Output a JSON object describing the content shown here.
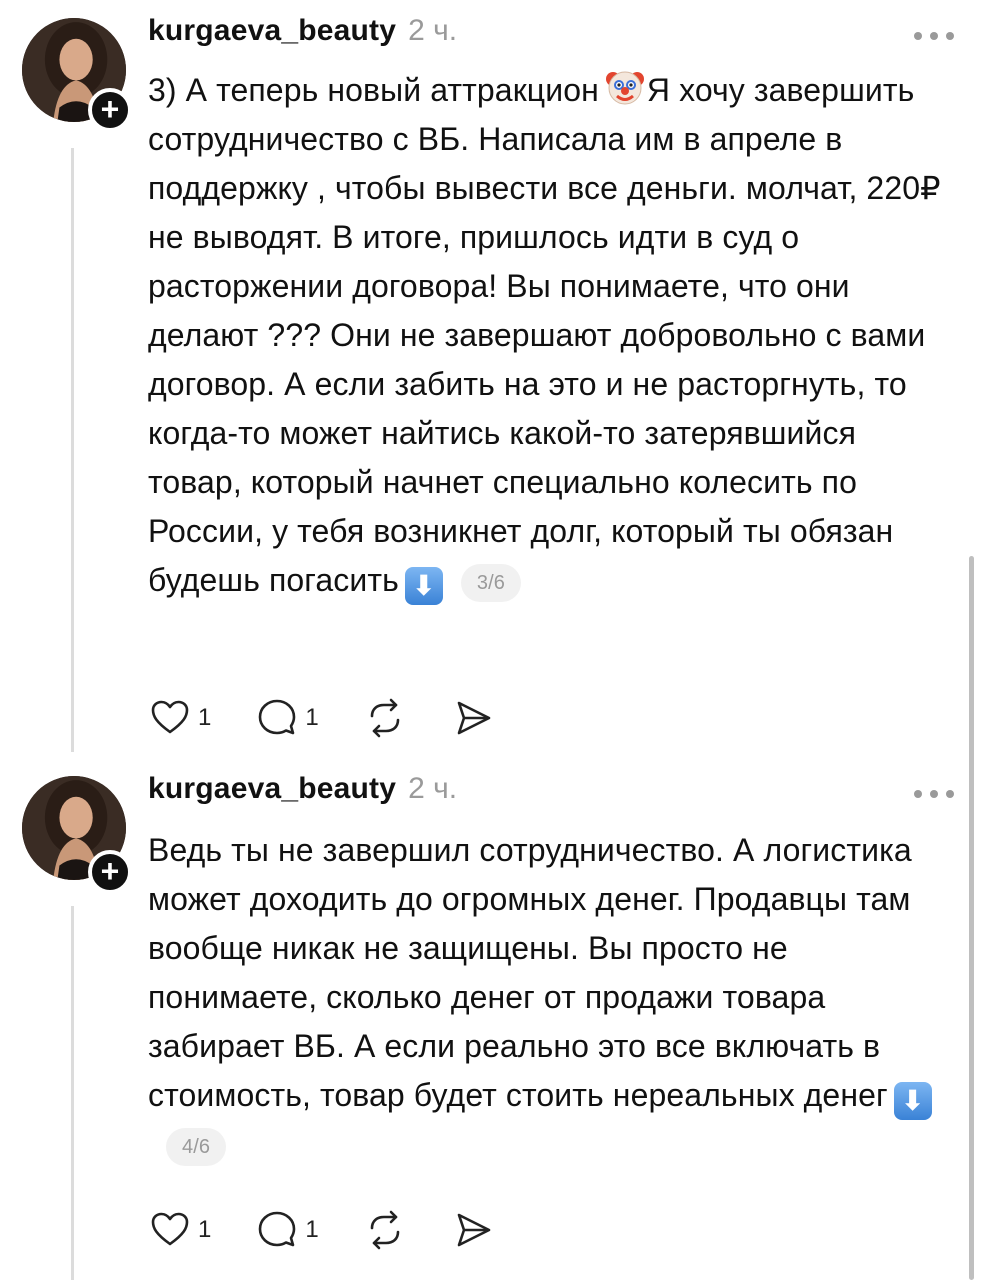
{
  "posts": [
    {
      "username": "kurgaeva_beauty",
      "time": "2 ч.",
      "text_part1": "3) А теперь новый аттракцион",
      "text_part2": "Я хочу завершить сотрудничество с ВБ. Написала им в апреле в поддержку , чтобы вывести все деньги. молчат, 220₽ не выводят. В итоге, пришлось идти в суд о расторжении договора! Вы понимаете, что они делают ??? Они не завершают добровольно с вами договор. А если забить на это и не расторгнуть, то когда-то может найтись какой-то затерявшийся товар, который начнет специально колесить по России, у тебя возникнет долг, который ты обязан будешь погасить",
      "page": "3/6",
      "likes": "1",
      "replies": "1"
    },
    {
      "username": "kurgaeva_beauty",
      "time": "2 ч.",
      "text": "Ведь ты не завершил сотрудничество. А логистика может доходить до огромных денег. Продавцы там вообще никак не защищены. Вы просто не понимаете, сколько денег от продажи товара забирает ВБ. А если реально это все включать в стоимость, товар будет стоить нереальных денег",
      "page": "4/6",
      "likes": "1",
      "replies": "1"
    }
  ],
  "icons": {
    "follow": "+",
    "arrow_down_emoji": "⬇",
    "clown_emoji": "clown-face"
  },
  "colors": {
    "text": "#111111",
    "muted": "#9a9a9a",
    "thread_line": "#dcdcdc",
    "emoji_blue": "#3a82d6"
  }
}
